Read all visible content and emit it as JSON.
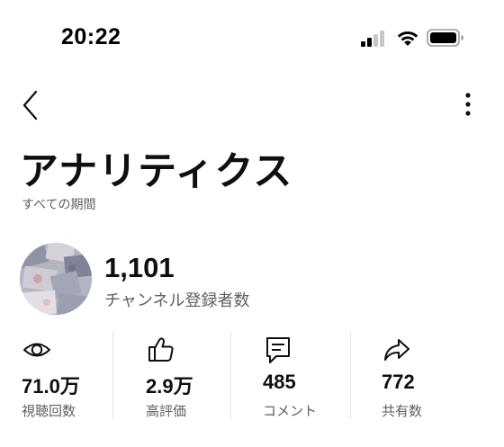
{
  "status_bar": {
    "time": "20:22",
    "icons": [
      "cellular-signal-icon",
      "wifi-icon",
      "battery-icon"
    ]
  },
  "top_bar": {
    "back_icon": "chevron-left-icon",
    "more_icon": "more-vertical-icon"
  },
  "page": {
    "title": "アナリティクス",
    "period": "すべての期間"
  },
  "channel": {
    "subscriber_count": "1,101",
    "subscriber_label": "チャンネル登録者数"
  },
  "metrics": [
    {
      "icon": "eye-icon",
      "value": "71.0万",
      "label": "視聴回数"
    },
    {
      "icon": "thumbs-up-icon",
      "value": "2.9万",
      "label": "高評価"
    },
    {
      "icon": "comment-icon",
      "value": "485",
      "label": "コメント"
    },
    {
      "icon": "share-icon",
      "value": "772",
      "label": "共有数"
    }
  ],
  "colors": {
    "text_primary": "#0f0f0f",
    "text_secondary": "#606060",
    "divider": "#e5e5e5",
    "background": "#ffffff"
  }
}
